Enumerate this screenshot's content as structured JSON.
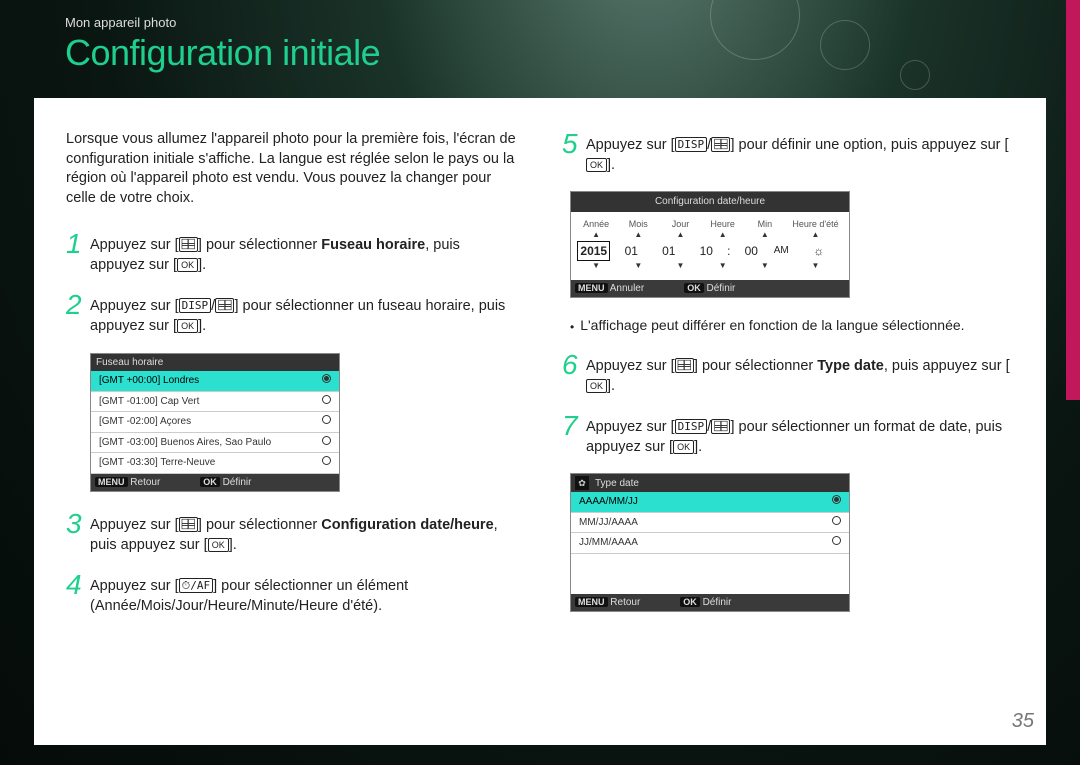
{
  "header": {
    "breadcrumb": "Mon appareil photo"
  },
  "title": "Configuration initiale",
  "intro": "Lorsque vous allumez l'appareil photo pour la première fois, l'écran de configuration initiale s'affiche. La langue est réglée selon le pays ou la région où l'appareil photo est vendu. Vous pouvez la changer pour celle de votre choix.",
  "icons": {
    "disp": "DISP",
    "macro_timer": "⌸⌸",
    "ok": "OK",
    "timer_af": "⏱/AF"
  },
  "steps": {
    "s1a": "Appuyez sur [",
    "s1b": "] pour sélectionner ",
    "s1bold": "Fuseau horaire",
    "s1c": ", puis appuyez sur [",
    "s1d": "].",
    "s2a": "Appuyez sur [",
    "s2b": "] pour sélectionner un fuseau horaire, puis appuyez sur [",
    "s2c": "].",
    "s3a": "Appuyez sur [",
    "s3b": "] pour sélectionner ",
    "s3bold": "Configuration date/heure",
    "s3c": ", puis appuyez sur [",
    "s3d": "].",
    "s4a": "Appuyez sur [",
    "s4b": "] pour sélectionner un élément (Année/Mois/Jour/Heure/Minute/Heure d'été).",
    "s5a": "Appuyez sur [",
    "s5b": "] pour définir une option, puis appuyez sur [",
    "s5c": "].",
    "s6a": "Appuyez sur [",
    "s6b": "] pour sélectionner ",
    "s6bold": "Type date",
    "s6c": ", puis appuyez sur [",
    "s6d": "].",
    "s7a": "Appuyez sur [",
    "s7b": "] pour sélectionner un format de date, puis appuyez sur [",
    "s7c": "]."
  },
  "tzscreen": {
    "title": "Fuseau horaire",
    "rows": [
      "[GMT +00:00] Londres",
      "[GMT -01:00] Cap Vert",
      "[GMT -02:00] Açores",
      "[GMT -03:00] Buenos Aires, Sao Paulo",
      "[GMT -03:30] Terre-Neuve"
    ],
    "foot_menu_tag": "MENU",
    "foot_menu": "Retour",
    "foot_ok_tag": "OK",
    "foot_ok": "Définir"
  },
  "datescreen": {
    "title": "Configuration date/heure",
    "labels": [
      "Année",
      "Mois",
      "Jour",
      "Heure",
      "Min",
      "Heure d'été"
    ],
    "vals": {
      "year": "2015",
      "month": "01",
      "day": "01",
      "hour": "10",
      "min": "00",
      "ampm": "AM",
      "dst": "☼"
    },
    "foot_menu_tag": "MENU",
    "foot_menu": "Annuler",
    "foot_ok_tag": "OK",
    "foot_ok": "Définir"
  },
  "note": "L'affichage peut différer en fonction de la langue sélectionnée.",
  "typescreen": {
    "title": "Type date",
    "rows": [
      "AAAA/MM/JJ",
      "MM/JJ/AAAA",
      "JJ/MM/AAAA"
    ],
    "foot_menu_tag": "MENU",
    "foot_menu": "Retour",
    "foot_ok_tag": "OK",
    "foot_ok": "Définir"
  },
  "pagenum": "35"
}
